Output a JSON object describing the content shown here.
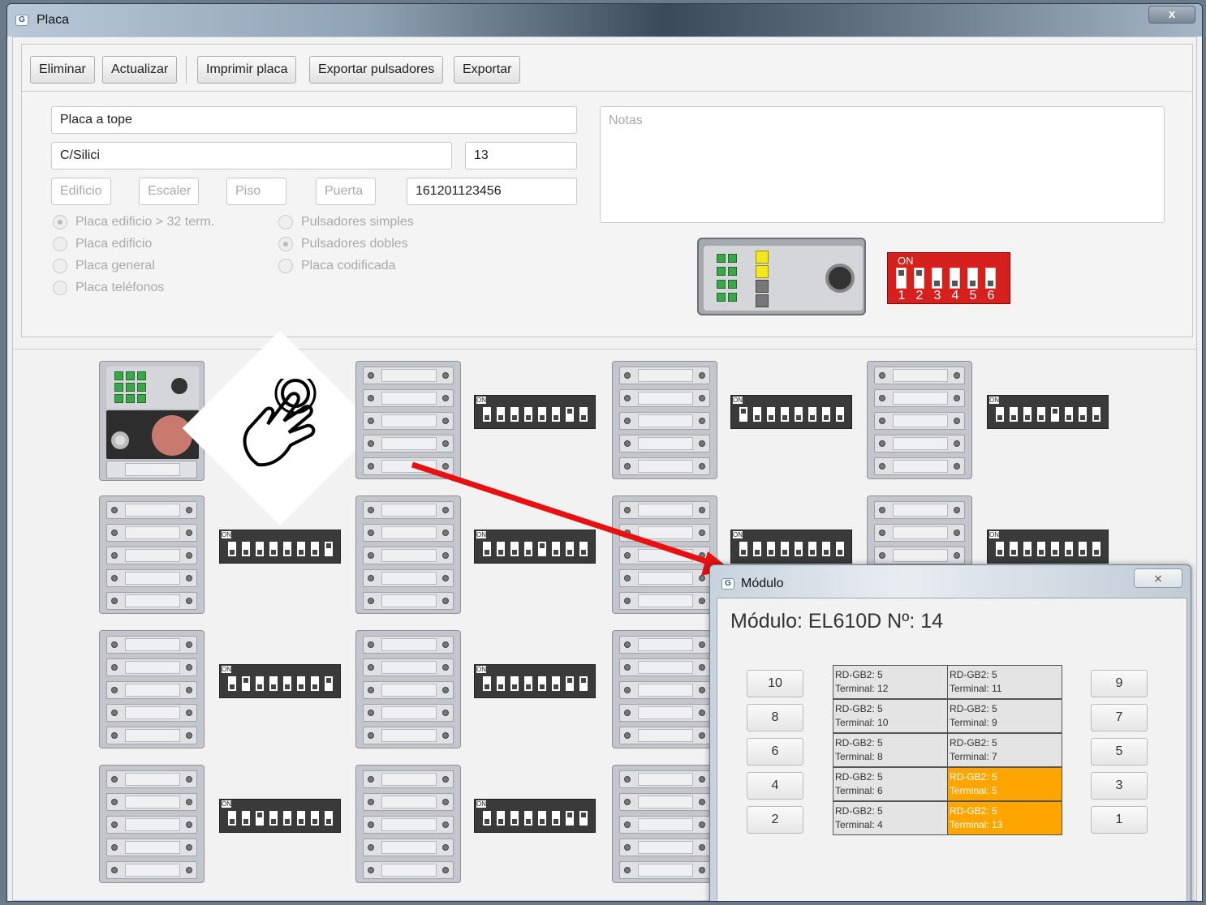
{
  "window": {
    "title": "Placa",
    "close_label": "x",
    "app_icon_letter": "G"
  },
  "toolbar": {
    "eliminar": "Eliminar",
    "actualizar": "Actualizar",
    "imprimir": "Imprimir placa",
    "exportar_pulsadores": "Exportar pulsadores",
    "exportar": "Exportar"
  },
  "form": {
    "name": "Placa a tope",
    "street": "C/Silici",
    "number": "13",
    "edificio_placeholder": "Edificio",
    "escalera_placeholder": "Escaler",
    "piso_placeholder": "Piso",
    "puerta_placeholder": "Puerta",
    "code": "161201123456",
    "notas_placeholder": "Notas"
  },
  "plate_type": [
    {
      "label": "Placa edificio > 32 term.",
      "selected": true
    },
    {
      "label": "Placa edificio",
      "selected": false
    },
    {
      "label": "Placa general",
      "selected": false
    },
    {
      "label": "Placa teléfonos",
      "selected": false
    }
  ],
  "button_type": [
    {
      "label": "Pulsadores simples",
      "selected": false
    },
    {
      "label": "Pulsadores dobles",
      "selected": true
    },
    {
      "label": "Placa codificada",
      "selected": false
    }
  ],
  "dip_switch": {
    "on_label": "ON",
    "numbers": [
      "1",
      "2",
      "3",
      "4",
      "5",
      "6"
    ],
    "states_up": [
      true,
      true,
      false,
      false,
      false,
      false
    ],
    "color": "#d6201d"
  },
  "small_dip_on_label": "ON",
  "dialog": {
    "title": "Módulo",
    "close_label": "⨯",
    "heading": "Módulo: EL610D Nº: 14",
    "left_buttons": [
      "10",
      "8",
      "6",
      "4",
      "2"
    ],
    "right_buttons": [
      "9",
      "7",
      "5",
      "3",
      "1"
    ],
    "grid": [
      [
        {
          "line1": "RD-GB2: 5",
          "line2": "Terminal: 12",
          "selected": false
        },
        {
          "line1": "RD-GB2: 5",
          "line2": "Terminal: 11",
          "selected": false
        }
      ],
      [
        {
          "line1": "RD-GB2: 5",
          "line2": "Terminal: 10",
          "selected": false
        },
        {
          "line1": "RD-GB2: 5",
          "line2": "Terminal: 9",
          "selected": false
        }
      ],
      [
        {
          "line1": "RD-GB2: 5",
          "line2": "Terminal: 8",
          "selected": false
        },
        {
          "line1": "RD-GB2: 5",
          "line2": "Terminal: 7",
          "selected": false
        }
      ],
      [
        {
          "line1": "RD-GB2: 5",
          "line2": "Terminal: 6",
          "selected": false
        },
        {
          "line1": "RD-GB2: 5",
          "line2": "Terminal: 5",
          "selected": true
        }
      ],
      [
        {
          "line1": "RD-GB2: 5",
          "line2": "Terminal: 4",
          "selected": false
        },
        {
          "line1": "RD-GB2: 5",
          "line2": "Terminal: 13",
          "selected": true
        }
      ]
    ],
    "selected_color": "#ffa500"
  },
  "annotation": {
    "arrow_color": "#e81010",
    "hand_icon": "pointer-hand-icon"
  }
}
